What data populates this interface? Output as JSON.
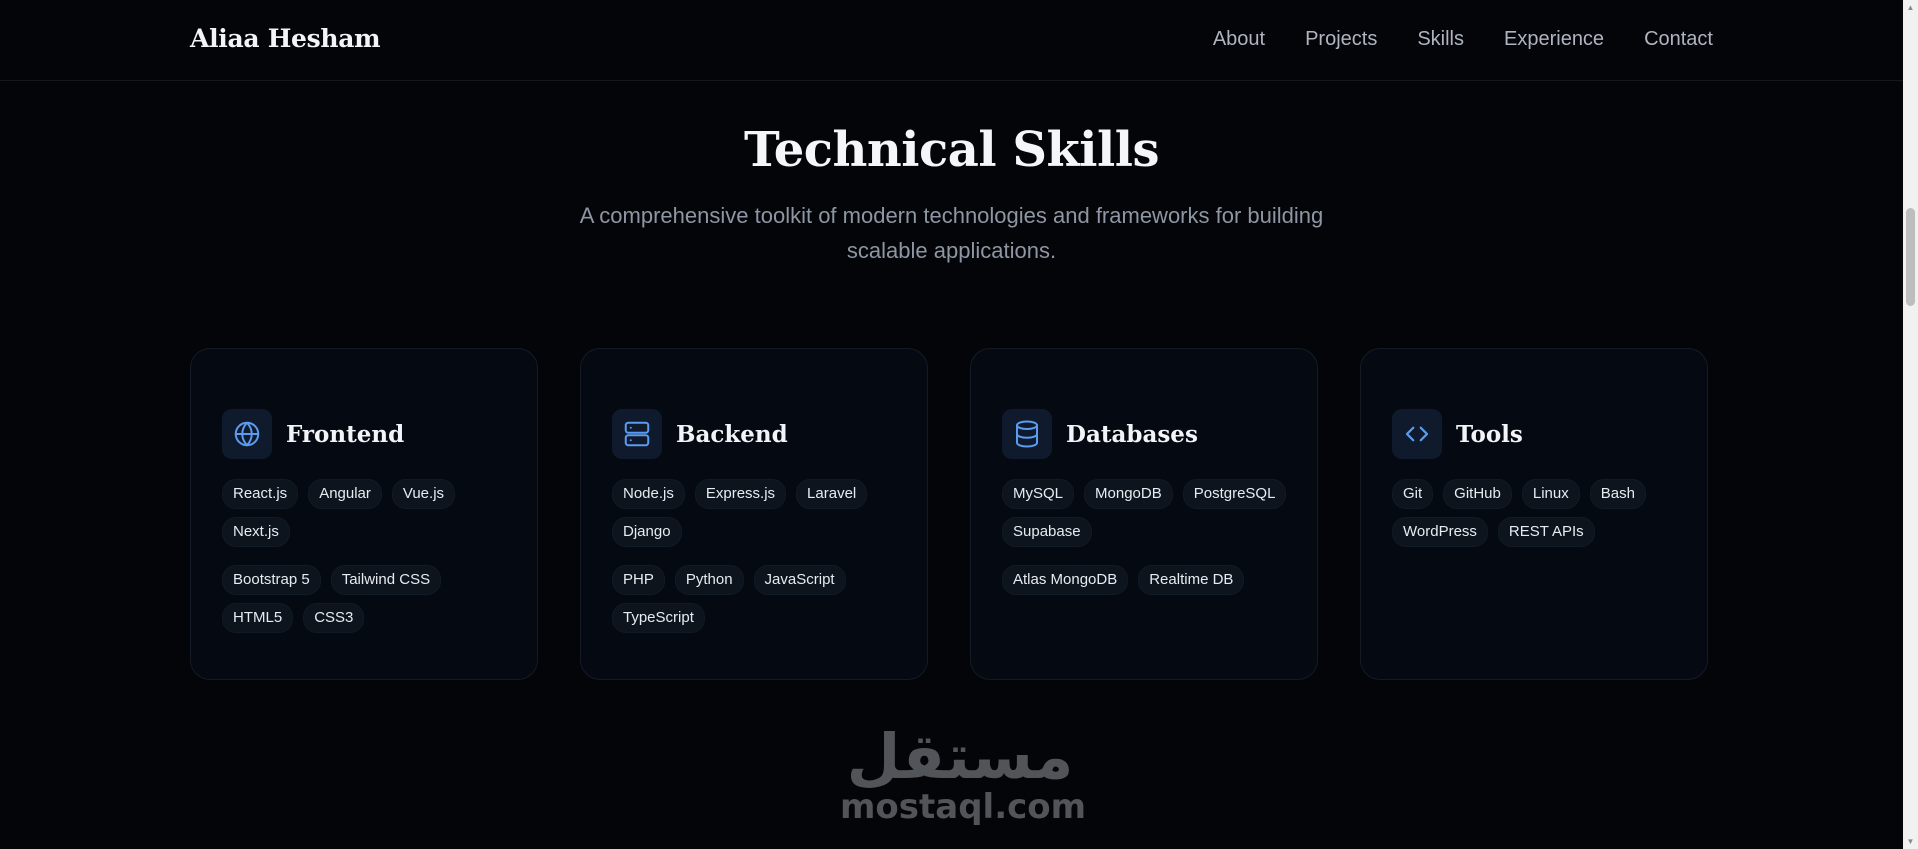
{
  "brand": "Aliaa Hesham",
  "nav": [
    "About",
    "Projects",
    "Skills",
    "Experience",
    "Contact"
  ],
  "section": {
    "title": "Technical Skills",
    "subtitle": "A comprehensive toolkit of modern technologies and frameworks for building scalable applications."
  },
  "cards": [
    {
      "title": "Frontend",
      "icon": "globe-icon",
      "rows": [
        [
          "React.js",
          "Angular",
          "Vue.js",
          "Next.js"
        ],
        [
          "Bootstrap 5",
          "Tailwind CSS",
          "HTML5",
          "CSS3"
        ]
      ]
    },
    {
      "title": "Backend",
      "icon": "server-icon",
      "rows": [
        [
          "Node.js",
          "Express.js",
          "Laravel",
          "Django"
        ],
        [
          "PHP",
          "Python",
          "JavaScript",
          "TypeScript"
        ]
      ]
    },
    {
      "title": "Databases",
      "icon": "database-icon",
      "rows": [
        [
          "MySQL",
          "MongoDB",
          "PostgreSQL",
          "Supabase"
        ],
        [
          "Atlas MongoDB",
          "Realtime DB"
        ]
      ]
    },
    {
      "title": "Tools",
      "icon": "code-icon",
      "rows": [
        [
          "Git",
          "GitHub",
          "Linux",
          "Bash",
          "WordPress",
          "REST APIs"
        ]
      ]
    }
  ],
  "watermark": {
    "arabic": "مستقل",
    "latin": "mostaql.com"
  },
  "colors": {
    "background": "#030508",
    "card": "#050a12",
    "accent": "#5b9cf0",
    "muted_text": "#8e96a3"
  }
}
